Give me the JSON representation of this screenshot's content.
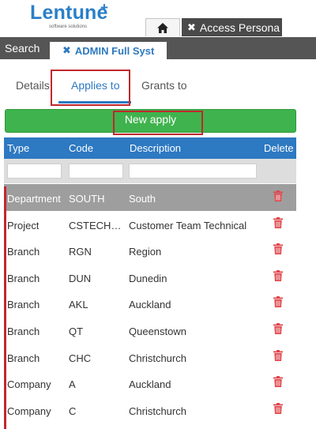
{
  "app": {
    "logo_text": "Lentune",
    "logo_plus": "+",
    "logo_sub": "software solutions"
  },
  "outer_tabs": {
    "home_icon": "home-icon",
    "active_label": "Access Persona",
    "close_glyph": "✖"
  },
  "inner_tabs": {
    "search_label": "Search",
    "active_label": "ADMIN Full Syst",
    "close_glyph": "✖"
  },
  "sub_tabs": {
    "details": "Details",
    "applies_to": "Applies to",
    "grants_to": "Grants to"
  },
  "new_apply_label": "New apply",
  "table": {
    "headers": {
      "type": "Type",
      "code": "Code",
      "description": "Description",
      "delete": "Delete"
    },
    "rows": [
      {
        "type": "Department",
        "code": "SOUTH",
        "description": "South"
      },
      {
        "type": "Project",
        "code": "CSTECH…",
        "description": "Customer Team Technical"
      },
      {
        "type": "Branch",
        "code": "RGN",
        "description": "Region"
      },
      {
        "type": "Branch",
        "code": "DUN",
        "description": "Dunedin"
      },
      {
        "type": "Branch",
        "code": "AKL",
        "description": "Auckland"
      },
      {
        "type": "Branch",
        "code": "QT",
        "description": "Queenstown"
      },
      {
        "type": "Branch",
        "code": "CHC",
        "description": "Christchurch"
      },
      {
        "type": "Company",
        "code": "A",
        "description": "Auckland"
      },
      {
        "type": "Company",
        "code": "C",
        "description": "Christchurch"
      }
    ]
  },
  "colors": {
    "brand_blue": "#2d79c2",
    "green_button": "#3fb34d",
    "delete_red": "#e0474c",
    "highlight_red": "#c0282d",
    "selected_row": "#9e9e9e"
  }
}
